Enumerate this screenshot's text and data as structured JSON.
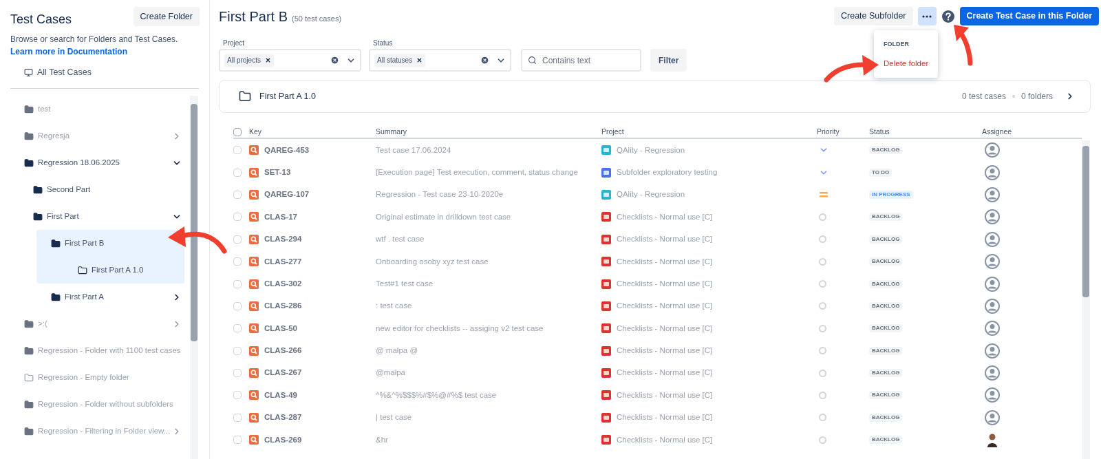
{
  "sidebar": {
    "title": "Test Cases",
    "create_button": "Create Folder",
    "description": "Browse or search for Folders and Test Cases.",
    "link": "Learn more in Documentation",
    "all_item": "All Test Cases",
    "tree": [
      {
        "label": "test",
        "kind": "folder",
        "muted": true,
        "selected": false
      },
      {
        "label": "Regresja",
        "kind": "folder",
        "muted": true,
        "selected": false,
        "expanded": false
      },
      {
        "label": "Regression 18.06.2025",
        "kind": "folder",
        "muted": false,
        "selected": false,
        "expanded": true,
        "children": [
          {
            "label": "Second Part",
            "kind": "folder",
            "muted": false,
            "selected": false
          },
          {
            "label": "First Part",
            "kind": "folder",
            "muted": false,
            "selected": false,
            "expanded": true,
            "children": [
              {
                "label": "First Part B",
                "kind": "folder",
                "muted": false,
                "selected": true,
                "children": [
                  {
                    "label": "First Part A 1.0",
                    "kind": "empty_folder",
                    "muted": false,
                    "selected": false
                  }
                ]
              },
              {
                "label": "First Part A",
                "kind": "folder",
                "muted": false,
                "selected": false,
                "expanded": false
              }
            ]
          }
        ]
      },
      {
        "label": ">:(",
        "kind": "folder",
        "muted": true,
        "selected": false,
        "expanded": false
      },
      {
        "label": "Regression - Folder with 1100 test cases",
        "kind": "folder",
        "muted": true,
        "selected": false
      },
      {
        "label": "Regression - Empty folder",
        "kind": "empty_folder",
        "muted": true,
        "selected": false
      },
      {
        "label": "Regression - Folder without subfolders",
        "kind": "folder",
        "muted": true,
        "selected": false
      },
      {
        "label": "Regression - Filtering in Folder view...",
        "kind": "folder",
        "muted": true,
        "selected": false,
        "expanded": false
      }
    ]
  },
  "header": {
    "title": "First Part B",
    "count": "(50 test cases)",
    "subfolder_button": "Create Subfolder",
    "create_button": "Create Test Case in this Folder",
    "more_menu": {
      "open": true,
      "heading": "FOLDER",
      "items": [
        {
          "label": "Delete folder",
          "kind": "danger"
        }
      ]
    }
  },
  "filters": {
    "project": {
      "label": "Project",
      "chip": "All projects"
    },
    "status": {
      "label": "Status",
      "chip": "All statuses"
    },
    "search": {
      "placeholder": "Contains text"
    },
    "button": "Filter"
  },
  "subfolder_card": {
    "name": "First Part A 1.0",
    "test_cases": "0 test cases",
    "folders": "0 folders"
  },
  "table": {
    "select_all_checked": false,
    "columns": [
      "Key",
      "Summary",
      "Project",
      "Priority",
      "Status",
      "Assignee"
    ],
    "rows": [
      {
        "checked": false,
        "key": "QAREG-453",
        "summary": "Test case 17.06.2024",
        "project": "QAlity - Regression",
        "color": "#22b8cf",
        "priority": {
          "kind": "low"
        },
        "status": {
          "text": "BACKLOG",
          "kind": "neutral"
        },
        "assignee": {
          "kind": "placeholder"
        }
      },
      {
        "checked": false,
        "key": "SET-13",
        "summary": "[Execution page] Test execution, comment, status change",
        "project": "Subfolder exploratory testing",
        "color": "#4c6ef5",
        "priority": {
          "kind": "low"
        },
        "status": {
          "text": "TO DO",
          "kind": "neutral"
        },
        "assignee": {
          "kind": "placeholder"
        }
      },
      {
        "checked": false,
        "key": "QAREG-107",
        "summary": "Regression - Test case 23-10-2020e",
        "project": "QAlity - Regression",
        "color": "#22b8cf",
        "priority": {
          "kind": "medium"
        },
        "status": {
          "text": "IN PROGRESS",
          "kind": "progress"
        },
        "assignee": {
          "kind": "placeholder"
        }
      },
      {
        "checked": false,
        "key": "CLAS-17",
        "summary": "Original estimate in drilldown test case",
        "project": "Checklists - Normal use [C]",
        "color": "#e03131",
        "priority": {
          "kind": "none"
        },
        "status": {
          "text": "BACKLOG",
          "kind": "neutral"
        },
        "assignee": {
          "kind": "placeholder"
        }
      },
      {
        "checked": false,
        "key": "CLAS-294",
        "summary": "wtf . test case",
        "project": "Checklists - Normal use [C]",
        "color": "#e03131",
        "priority": {
          "kind": "none"
        },
        "status": {
          "text": "BACKLOG",
          "kind": "neutral"
        },
        "assignee": {
          "kind": "placeholder"
        }
      },
      {
        "checked": false,
        "key": "CLAS-277",
        "summary": "Onboarding osoby xyz test case",
        "project": "Checklists - Normal use [C]",
        "color": "#e03131",
        "priority": {
          "kind": "none"
        },
        "status": {
          "text": "BACKLOG",
          "kind": "neutral"
        },
        "assignee": {
          "kind": "placeholder"
        }
      },
      {
        "checked": false,
        "key": "CLAS-302",
        "summary": "Test#1 test case",
        "project": "Checklists - Normal use [C]",
        "color": "#e03131",
        "priority": {
          "kind": "none"
        },
        "status": {
          "text": "BACKLOG",
          "kind": "neutral"
        },
        "assignee": {
          "kind": "placeholder"
        }
      },
      {
        "checked": false,
        "key": "CLAS-286",
        "summary": ": test case",
        "project": "Checklists - Normal use [C]",
        "color": "#e03131",
        "priority": {
          "kind": "none"
        },
        "status": {
          "text": "BACKLOG",
          "kind": "neutral"
        },
        "assignee": {
          "kind": "placeholder"
        }
      },
      {
        "checked": false,
        "key": "CLAS-50",
        "summary": "new editor for checklists -- assiging v2 test case",
        "project": "Checklists - Normal use [C]",
        "color": "#e03131",
        "priority": {
          "kind": "none"
        },
        "status": {
          "text": "BACKLOG",
          "kind": "neutral"
        },
        "assignee": {
          "kind": "placeholder"
        }
      },
      {
        "checked": false,
        "key": "CLAS-266",
        "summary": "@ małpa @",
        "project": "Checklists - Normal use [C]",
        "color": "#e03131",
        "priority": {
          "kind": "none"
        },
        "status": {
          "text": "BACKLOG",
          "kind": "neutral"
        },
        "assignee": {
          "kind": "placeholder"
        }
      },
      {
        "checked": false,
        "key": "CLAS-267",
        "summary": "@małpa",
        "project": "Checklists - Normal use [C]",
        "color": "#e03131",
        "priority": {
          "kind": "none"
        },
        "status": {
          "text": "BACKLOG",
          "kind": "neutral"
        },
        "assignee": {
          "kind": "placeholder"
        }
      },
      {
        "checked": false,
        "key": "CLAS-49",
        "summary": "^%&^%$$$%#$%@#%$ test case",
        "project": "Checklists - Normal use [C]",
        "color": "#e03131",
        "priority": {
          "kind": "none"
        },
        "status": {
          "text": "BACKLOG",
          "kind": "neutral"
        },
        "assignee": {
          "kind": "placeholder"
        }
      },
      {
        "checked": false,
        "key": "CLAS-287",
        "summary": "| test case",
        "project": "Checklists - Normal use [C]",
        "color": "#e03131",
        "priority": {
          "kind": "none"
        },
        "status": {
          "text": "BACKLOG",
          "kind": "neutral"
        },
        "assignee": {
          "kind": "placeholder"
        }
      },
      {
        "checked": false,
        "key": "CLAS-269",
        "summary": "&hr",
        "project": "Checklists - Normal use [C]",
        "color": "#e03131",
        "priority": {
          "kind": "none"
        },
        "status": {
          "text": "BACKLOG",
          "kind": "neutral"
        },
        "assignee": {
          "kind": "photo"
        }
      }
    ]
  }
}
